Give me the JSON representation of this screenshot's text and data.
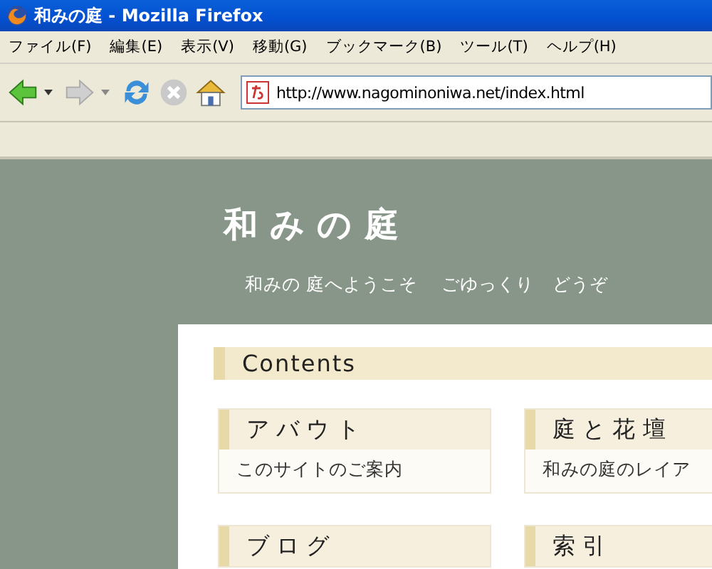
{
  "window": {
    "title": "和みの庭 - Mozilla Firefox"
  },
  "menu": [
    "ファイル(F)",
    "編集(E)",
    "表示(V)",
    "移動(G)",
    "ブックマーク(B)",
    "ツール(T)",
    "ヘルプ(H)"
  ],
  "toolbar": {
    "back_disabled": false,
    "forward_disabled": true,
    "stop_disabled": true
  },
  "address": {
    "value": "http://www.nagominoniwa.net/index.html"
  },
  "site": {
    "title": "和 み の 庭",
    "tagline": "和みの 庭へようこそ　 ごゆっくり　どうぞ"
  },
  "contents": {
    "heading": "Contents",
    "cards": [
      {
        "title": "ア バ ウ ト",
        "description": "このサイトのご案内"
      },
      {
        "title": "庭 と 花 壇",
        "description": "和みの庭のレイア"
      },
      {
        "title": "ブ ロ グ"
      },
      {
        "title": "索 引"
      }
    ]
  }
}
